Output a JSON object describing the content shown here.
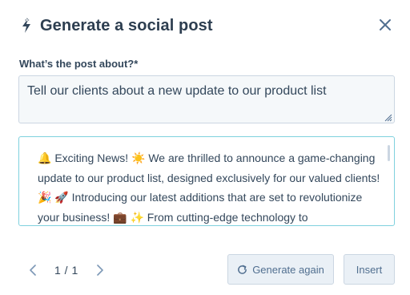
{
  "dialog": {
    "title": "Generate a social post",
    "close_icon": "close-icon",
    "title_icon": "ai-sparkle-icon"
  },
  "prompt": {
    "label": "What’s the post about?*",
    "value": "Tell our clients about a new update to our product list"
  },
  "result": {
    "text": "🔔 Exciting News! ☀️ We are thrilled to announce a game-changing update to our product list, designed exclusively for our valued clients! 🎉 🚀 Introducing our latest additions that are set to revolutionize your business! 💼 ✨ From cutting-edge technology to"
  },
  "pager": {
    "count": "1 / 1",
    "prev_icon": "chevron-left-icon",
    "next_icon": "chevron-right-icon"
  },
  "actions": {
    "generate_again_label": "Generate again",
    "generate_again_icon": "refresh-icon",
    "insert_label": "Insert"
  },
  "colors": {
    "accent": "#00a4bd",
    "result_border": "#7fd1de",
    "button_bg": "#eaf0f6",
    "text": "#33475b"
  }
}
